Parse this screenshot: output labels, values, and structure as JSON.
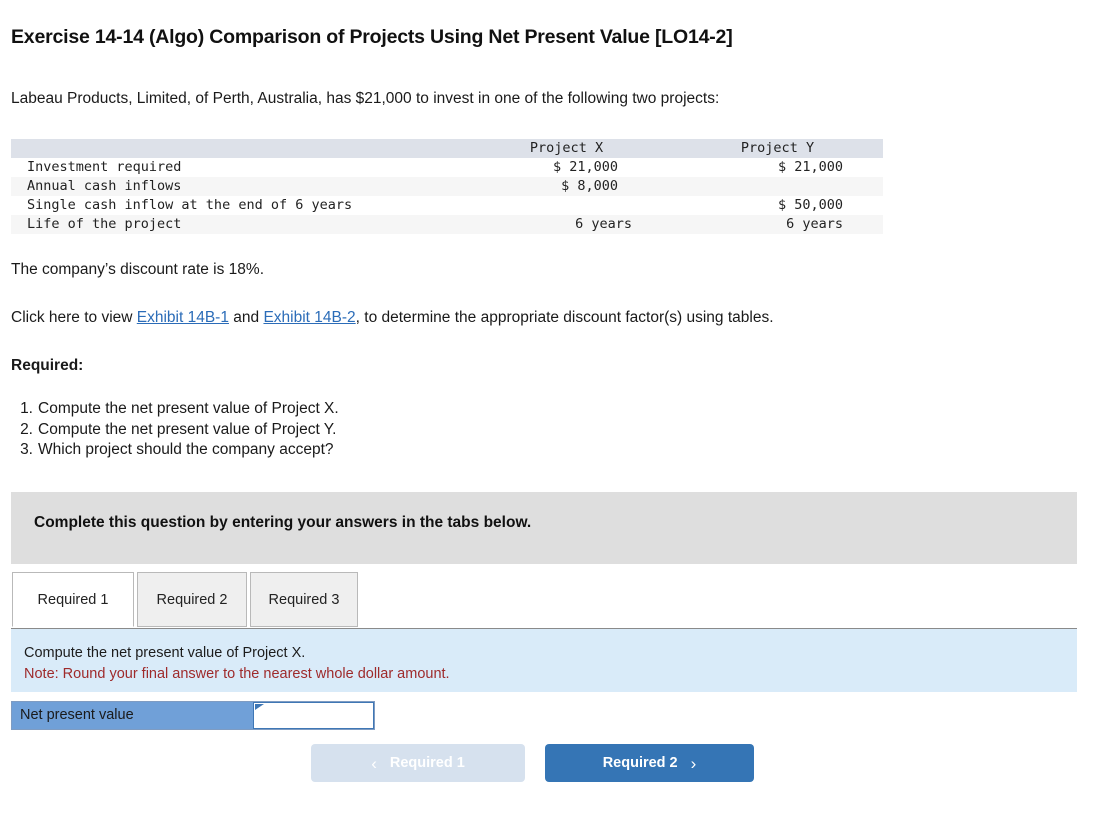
{
  "title": "Exercise 14-14 (Algo) Comparison of Projects Using Net Present Value [LO14-2]",
  "intro": "Labeau Products, Limited, of Perth, Australia, has $21,000 to invest in one of the following two projects:",
  "table": {
    "headers": [
      "",
      "Project X",
      "Project Y"
    ],
    "rows": [
      {
        "label": "Investment required",
        "x": "$ 21,000",
        "y": "$ 21,000"
      },
      {
        "label": "Annual cash inflows",
        "x": "$ 8,000",
        "y": ""
      },
      {
        "label": "Single cash inflow at the end of 6 years",
        "x": "",
        "y": "$ 50,000"
      },
      {
        "label": "Life of the project",
        "x": "6  years",
        "y": "6  years"
      }
    ]
  },
  "discount_line": "The company’s discount rate is 18%.",
  "exhibit_line": {
    "prefix": "Click here to view ",
    "link1": "Exhibit 14B-1",
    "middle": " and ",
    "link2": "Exhibit 14B-2",
    "suffix": ", to determine the appropriate discount factor(s) using tables."
  },
  "required_heading": "Required:",
  "required_items": [
    {
      "num": "1.",
      "text": "Compute the net present value of Project X."
    },
    {
      "num": "2.",
      "text": "Compute the net present value of Project Y."
    },
    {
      "num": "3.",
      "text": "Which project should the company accept?"
    }
  ],
  "banner_text": "Complete this question by entering your answers in the tabs below.",
  "tabs": [
    {
      "label": "Required 1",
      "active": true
    },
    {
      "label": "Required 2",
      "active": false
    },
    {
      "label": "Required 3",
      "active": false
    }
  ],
  "info_panel": {
    "instruction": "Compute the net present value of Project X.",
    "note": "Note: Round your final answer to the nearest whole dollar amount."
  },
  "answer": {
    "label": "Net present value",
    "value": "",
    "placeholder": ""
  },
  "nav": {
    "prev_label": "Required 1",
    "prev_chevron": "‹",
    "next_label": "Required 2",
    "next_chevron": "›"
  },
  "colors": {
    "accent_blue": "#3575b5",
    "link_blue": "#2b6cb8",
    "note_red": "#9e2a2b",
    "panel_blue": "#d9ebf9",
    "banner_gray": "#dedede",
    "label_blue": "#70a0d8"
  }
}
